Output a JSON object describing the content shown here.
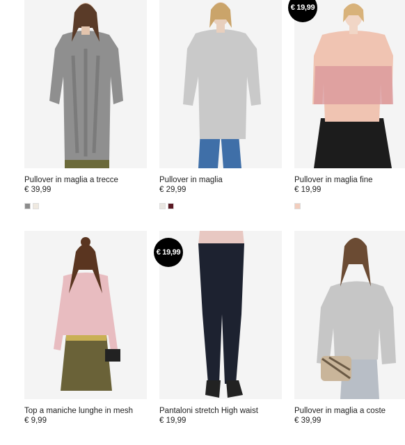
{
  "products": [
    {
      "name": "Pullover in maglia a trecce",
      "price": "€ 39,99",
      "badge": "",
      "swatches": [
        "#8c8c8c",
        "#efe9e0"
      ],
      "image": "grey-cable-knit-sweater-photo"
    },
    {
      "name": "Pullover in maglia",
      "price": "€ 29,99",
      "badge": "",
      "swatches": [
        "#e9e6e1",
        "#5b1a24"
      ],
      "image": "light-grey-sweater-photo"
    },
    {
      "name": "Pullover in maglia fine",
      "price": "€ 19,99",
      "badge": "€ 19,99",
      "swatches": [
        "#f2cdbd"
      ],
      "image": "pink-fine-knit-sweater-photo"
    },
    {
      "name": "Top a maniche lunghe in mesh",
      "price": "€ 9,99",
      "badge": "",
      "swatches": [],
      "image": "pink-mesh-top-photo"
    },
    {
      "name": "Pantaloni stretch High waist",
      "price": "€ 19,99",
      "badge": "€ 19,99",
      "swatches": [],
      "image": "dark-denim-jeans-photo"
    },
    {
      "name": "Pullover in maglia a coste",
      "price": "€ 39,99",
      "badge": "",
      "swatches": [],
      "image": "grey-ribbed-sweater-photo"
    }
  ]
}
